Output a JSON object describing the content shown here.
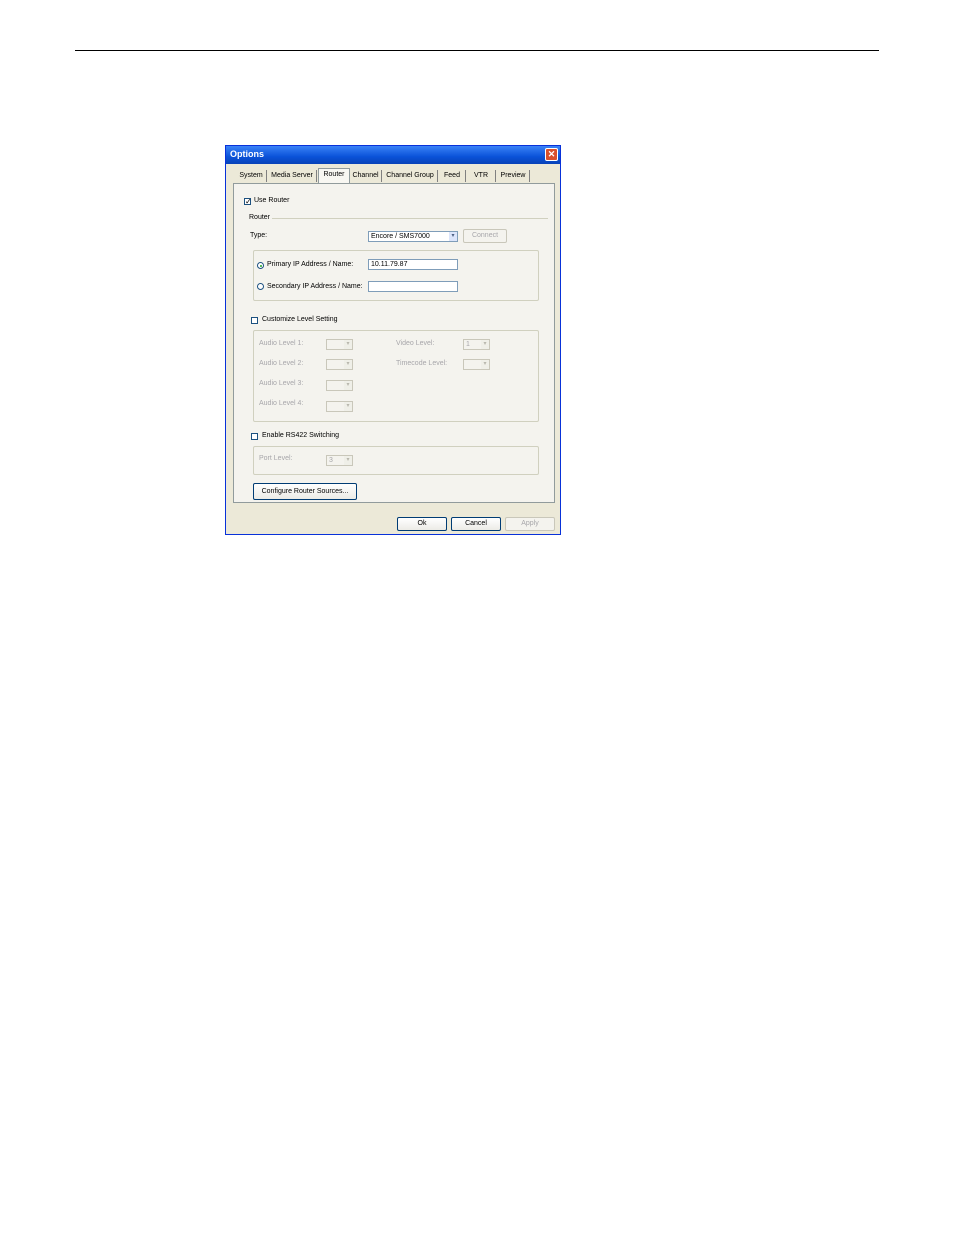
{
  "dialog": {
    "title": "Options",
    "close_symbol": "✕",
    "tabs": [
      "System",
      "Media Server",
      "Router",
      "Channel",
      "Channel Group",
      "Feed",
      "VTR",
      "Preview"
    ],
    "active_tab": "Router"
  },
  "router": {
    "use_router_label": "Use Router",
    "use_router_checked": "✓",
    "group_label": "Router",
    "type_label": "Type:",
    "type_value": "Encore / SMS7000",
    "connect_label": "Connect",
    "primary_label": "Primary IP Address / Name:",
    "primary_value": "10.11.79.87",
    "secondary_label": "Secondary IP Address / Name:",
    "secondary_value": ""
  },
  "levels": {
    "customize_label": "Customize Level Setting",
    "audio1": "Audio Level 1:",
    "audio2": "Audio Level 2:",
    "audio3": "Audio Level 3:",
    "audio4": "Audio Level 4:",
    "video": "Video Level:",
    "video_value": "1",
    "timecode": "Timecode Level:"
  },
  "rs422": {
    "enable_label": "Enable RS422 Switching",
    "port_level_label": "Port Level:",
    "port_level_value": "3"
  },
  "buttons": {
    "configure": "Configure Router Sources...",
    "ok": "Ok",
    "cancel": "Cancel",
    "apply": "Apply"
  },
  "icons": {
    "dropdown": "▾"
  }
}
